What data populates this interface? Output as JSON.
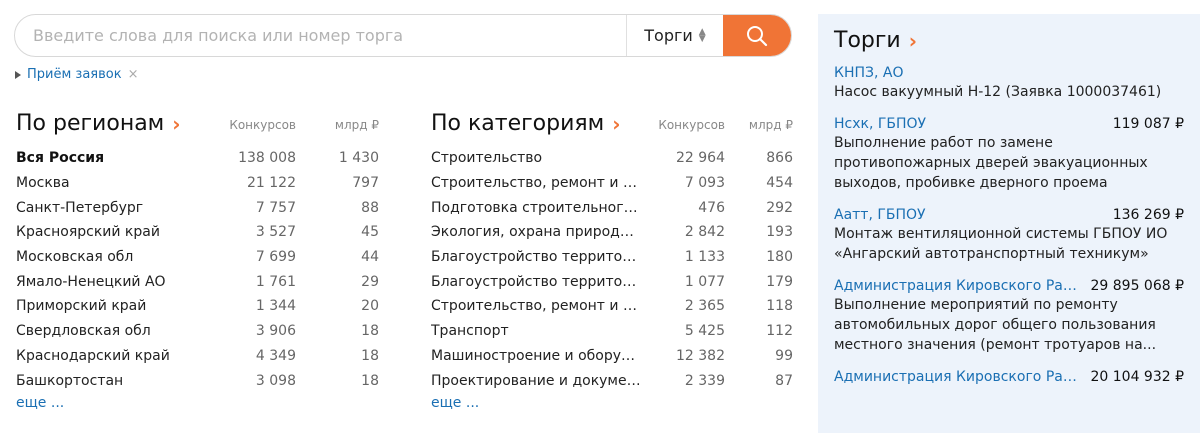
{
  "search": {
    "placeholder": "Введите слова для поиска или номер торга",
    "value": "",
    "scope": "Торги"
  },
  "filter": {
    "label": "Приём заявок"
  },
  "regions": {
    "title": "По регионам",
    "col_count": "Конкурсов",
    "col_amount": "млрд ₽",
    "rows": [
      {
        "name": "Вся Россия",
        "count": "138 008",
        "amount": "1 430"
      },
      {
        "name": "Москва",
        "count": "21 122",
        "amount": "797"
      },
      {
        "name": "Санкт-Петербург",
        "count": "7 757",
        "amount": "88"
      },
      {
        "name": "Красноярский край",
        "count": "3 527",
        "amount": "45"
      },
      {
        "name": "Московская обл",
        "count": "7 699",
        "amount": "44"
      },
      {
        "name": "Ямало-Ненецкий АО",
        "count": "1 761",
        "amount": "29"
      },
      {
        "name": "Приморский край",
        "count": "1 344",
        "amount": "20"
      },
      {
        "name": "Свердловская обл",
        "count": "3 906",
        "amount": "18"
      },
      {
        "name": "Краснодарский край",
        "count": "4 349",
        "amount": "18"
      },
      {
        "name": "Башкортостан",
        "count": "3 098",
        "amount": "18"
      }
    ],
    "more": "еще ..."
  },
  "categories": {
    "title": "По категориям",
    "col_count": "Конкурсов",
    "col_amount": "млрд ₽",
    "rows": [
      {
        "name": "Строительство",
        "count": "22 964",
        "amount": "866"
      },
      {
        "name": "Строительство, ремонт и рек...",
        "count": "7 093",
        "amount": "454"
      },
      {
        "name": "Подготовка строительного уч...",
        "count": "476",
        "amount": "292"
      },
      {
        "name": "Экология, охрана природы, у...",
        "count": "2 842",
        "amount": "193"
      },
      {
        "name": "Благоустройство территорий ...",
        "count": "1 133",
        "amount": "180"
      },
      {
        "name": "Благоустройство территорий",
        "count": "1 077",
        "amount": "179"
      },
      {
        "name": "Строительство, ремонт и обс...",
        "count": "2 365",
        "amount": "118"
      },
      {
        "name": "Транспорт",
        "count": "5 425",
        "amount": "112"
      },
      {
        "name": "Машиностроение и оборудов...",
        "count": "12 382",
        "amount": "99"
      },
      {
        "name": "Проектирование и документ...",
        "count": "2 339",
        "amount": "87"
      }
    ],
    "more": "еще ..."
  },
  "tenders": {
    "title": "Торги",
    "items": [
      {
        "org": "КНПЗ, АО",
        "price": "",
        "desc": "Насос вакуумный Н-12 (Заявка 1000037461)"
      },
      {
        "org": "Нсхк, ГБПОУ",
        "price": "119 087 ₽",
        "desc": "Выполнение работ по замене противопожарных дверей эвакуационных выходов, пробивке дверного проема"
      },
      {
        "org": "Аатт, ГБПОУ",
        "price": "136 269 ₽",
        "desc": "Монтаж вентиляционной системы ГБПОУ ИО «Ангарский автотранспортный техникум»"
      },
      {
        "org": "Администрация Кировского Района...",
        "price": "29 895 068 ₽",
        "desc": "Выполнение мероприятий по ремонту автомобильных дорог общего пользования местного значения (ремонт тротуаров на..."
      },
      {
        "org": "Администрация Кировского Района...",
        "price": "20 104 932 ₽",
        "desc": ""
      }
    ]
  },
  "colors": {
    "accent": "#f07436",
    "link": "#1a6fb3",
    "panel_bg": "#edf3fb"
  }
}
